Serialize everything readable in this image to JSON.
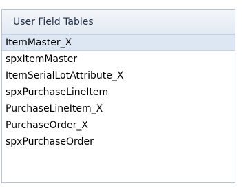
{
  "panel": {
    "header_label": "User Field Tables",
    "items": [
      {
        "label": "ItemMaster_X",
        "selected": true
      },
      {
        "label": "spxItemMaster",
        "selected": false
      },
      {
        "label": "ItemSerialLotAttribute_X",
        "selected": false
      },
      {
        "label": "spxPurchaseLineItem",
        "selected": false
      },
      {
        "label": "PurchaseLineItem_X",
        "selected": false
      },
      {
        "label": "PurchaseOrder_X",
        "selected": false
      },
      {
        "label": "spxPurchaseOrder",
        "selected": false
      }
    ]
  },
  "colors": {
    "header_bg": "#e9eef5",
    "selected_row_bg": "#dde7f3",
    "border": "#b7c3d4"
  }
}
